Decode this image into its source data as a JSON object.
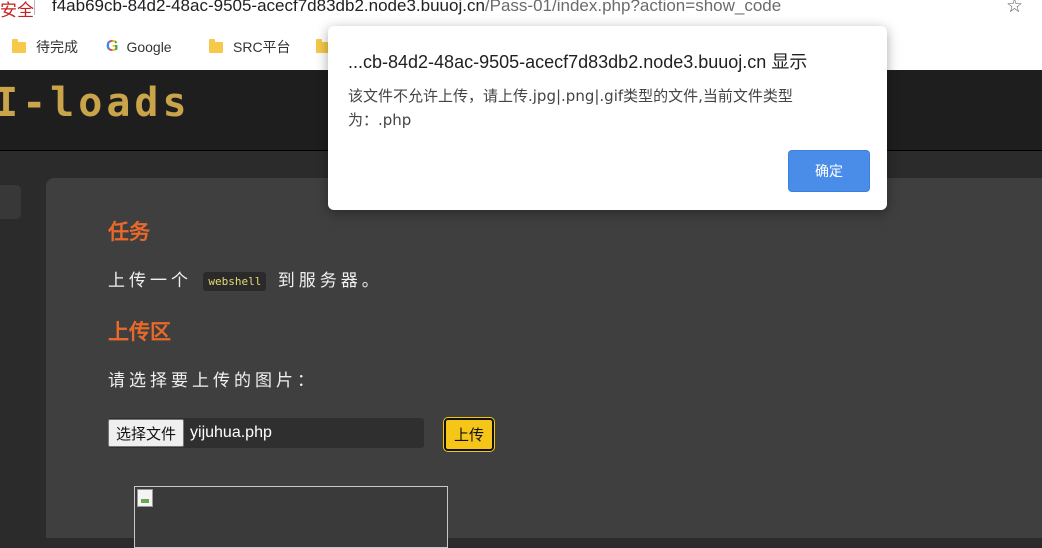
{
  "browser": {
    "security_label": "安全",
    "url_host": "f4ab69cb-84d2-48ac-9505-acecf7d83db2.node3.buuoj.cn",
    "url_path": "/Pass-01/index.php?action=show_code",
    "bookmarks": [
      {
        "label": "待完成",
        "icon": "folder-icon"
      },
      {
        "label": "Google",
        "icon": "google-icon"
      },
      {
        "label": "SRC平台",
        "icon": "folder-icon"
      }
    ]
  },
  "site": {
    "logo_text": "I-loads"
  },
  "task": {
    "title": "任务",
    "text_before": "上传一个",
    "code": "webshell",
    "text_after": "到服务器。"
  },
  "upload": {
    "title": "上传区",
    "prompt": "请选择要上传的图片：",
    "choose_button": "选择文件",
    "file_name": "yijuhua.php",
    "submit_button": "上传"
  },
  "dialog": {
    "title": "...cb-84d2-48ac-9505-acecf7d83db2.node3.buuoj.cn 显示",
    "message": "该文件不允许上传，请上传.jpg|.png|.gif类型的文件,当前文件类型为：.php",
    "ok_button": "确定"
  },
  "colors": {
    "accent_orange": "#e8692a",
    "upload_yellow": "#f5c518",
    "dialog_button_blue": "#4a8de8",
    "logo_gold": "#c9a44a"
  }
}
